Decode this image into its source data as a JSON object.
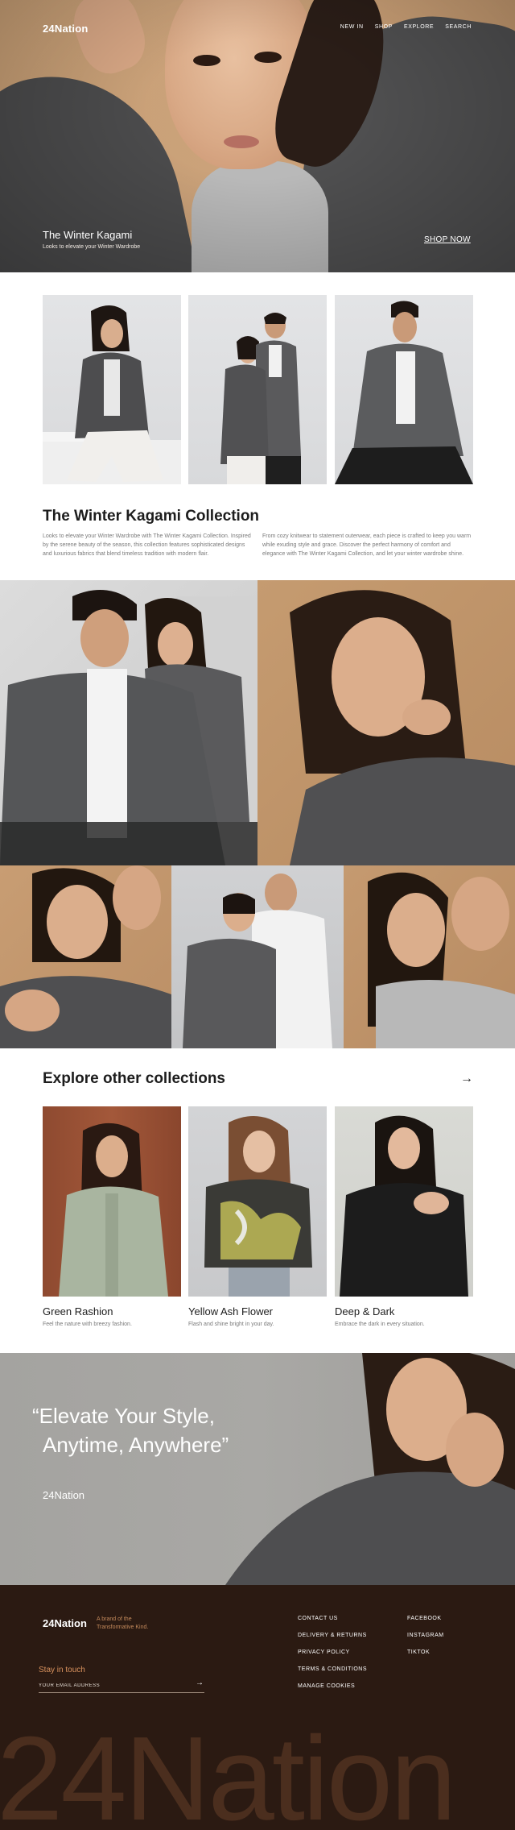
{
  "brand": {
    "logo": "24Nation"
  },
  "nav": {
    "items": [
      "NEW IN",
      "SHOP",
      "EXPLORE",
      "SEARCH"
    ]
  },
  "hero": {
    "title": "The Winter Kagami",
    "subtitle": "Looks to elevate your Winter Wardrobe",
    "cta": "SHOP NOW"
  },
  "collection": {
    "title": "The Winter Kagami Collection",
    "paragraph_left": "Looks to elevate your Winter Wardrobe with The Winter Kagami Collection. Inspired by the serene beauty of the season, this collection features sophisticated designs and luxurious fabrics that blend timeless tradition with modern flair.",
    "paragraph_right": "From cozy knitwear to statement outerwear, each piece is crafted to keep you warm while exuding style and grace. Discover the perfect harmony of comfort and elegance with The Winter Kagami Collection, and let your winter wardrobe shine."
  },
  "explore": {
    "title": "Explore other collections",
    "arrow": "→",
    "items": [
      {
        "name": "Green Rashion",
        "desc": "Feel the nature with breezy fashion."
      },
      {
        "name": "Yellow Ash Flower",
        "desc": "Flash and shine bright in your day."
      },
      {
        "name": "Deep & Dark",
        "desc": "Embrace the dark in every situation."
      }
    ]
  },
  "quote": {
    "line1": "“Elevate Your Style,",
    "line2": "Anytime, Anywhere”",
    "author": "24Nation"
  },
  "footer": {
    "logo": "24Nation",
    "tagline_1": "A brand of the",
    "tagline_2": "Transformative Kind.",
    "stay_in_touch": "Stay in touch",
    "email_placeholder": "YOUR EMAIL ADDRESS",
    "submit_arrow": "→",
    "links_col1": [
      "CONTACT US",
      "DELIVERY & RETURNS",
      "PRIVACY POLICY",
      "TERMS & CONDITIONS",
      "MANAGE COOKIES"
    ],
    "links_col2": [
      "FACEBOOK",
      "INSTAGRAM",
      "TIKTOK"
    ],
    "big_wordmark": "24Nation"
  },
  "colors": {
    "accent_orange": "#d9925e",
    "footer_bg": "#2b1a12",
    "hero_bg": "#c9a076",
    "text_dark": "#1d1d1d",
    "text_muted": "#7a7a7a"
  }
}
